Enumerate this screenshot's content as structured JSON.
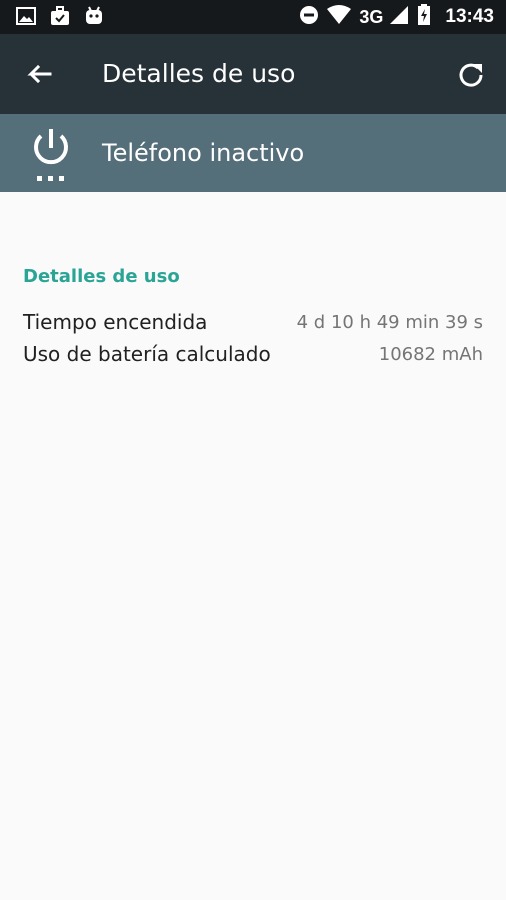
{
  "status_bar": {
    "left_icons": [
      "image-icon",
      "briefcase-icon",
      "android-icon"
    ],
    "right_icons": [
      "do-not-disturb-icon",
      "wifi-icon",
      "signal-icon",
      "battery-charging-icon"
    ],
    "network": "3G",
    "time": "13:43"
  },
  "toolbar": {
    "title": "Detalles de uso",
    "back_icon": "arrow-back-icon",
    "refresh_icon": "refresh-icon"
  },
  "header": {
    "icon": "power-icon",
    "title": "Teléfono inactivo"
  },
  "section": {
    "title": "Detalles de uso",
    "rows": [
      {
        "label": "Tiempo encendida",
        "value": "4 d 10 h 49 min 39 s"
      },
      {
        "label": "Uso de batería calculado",
        "value": "10682 mAh"
      }
    ]
  },
  "colors": {
    "status_bar": "#16191b",
    "toolbar": "#263238",
    "header_band": "#546e7a",
    "accent": "#2aa495",
    "background": "#fafafa"
  }
}
